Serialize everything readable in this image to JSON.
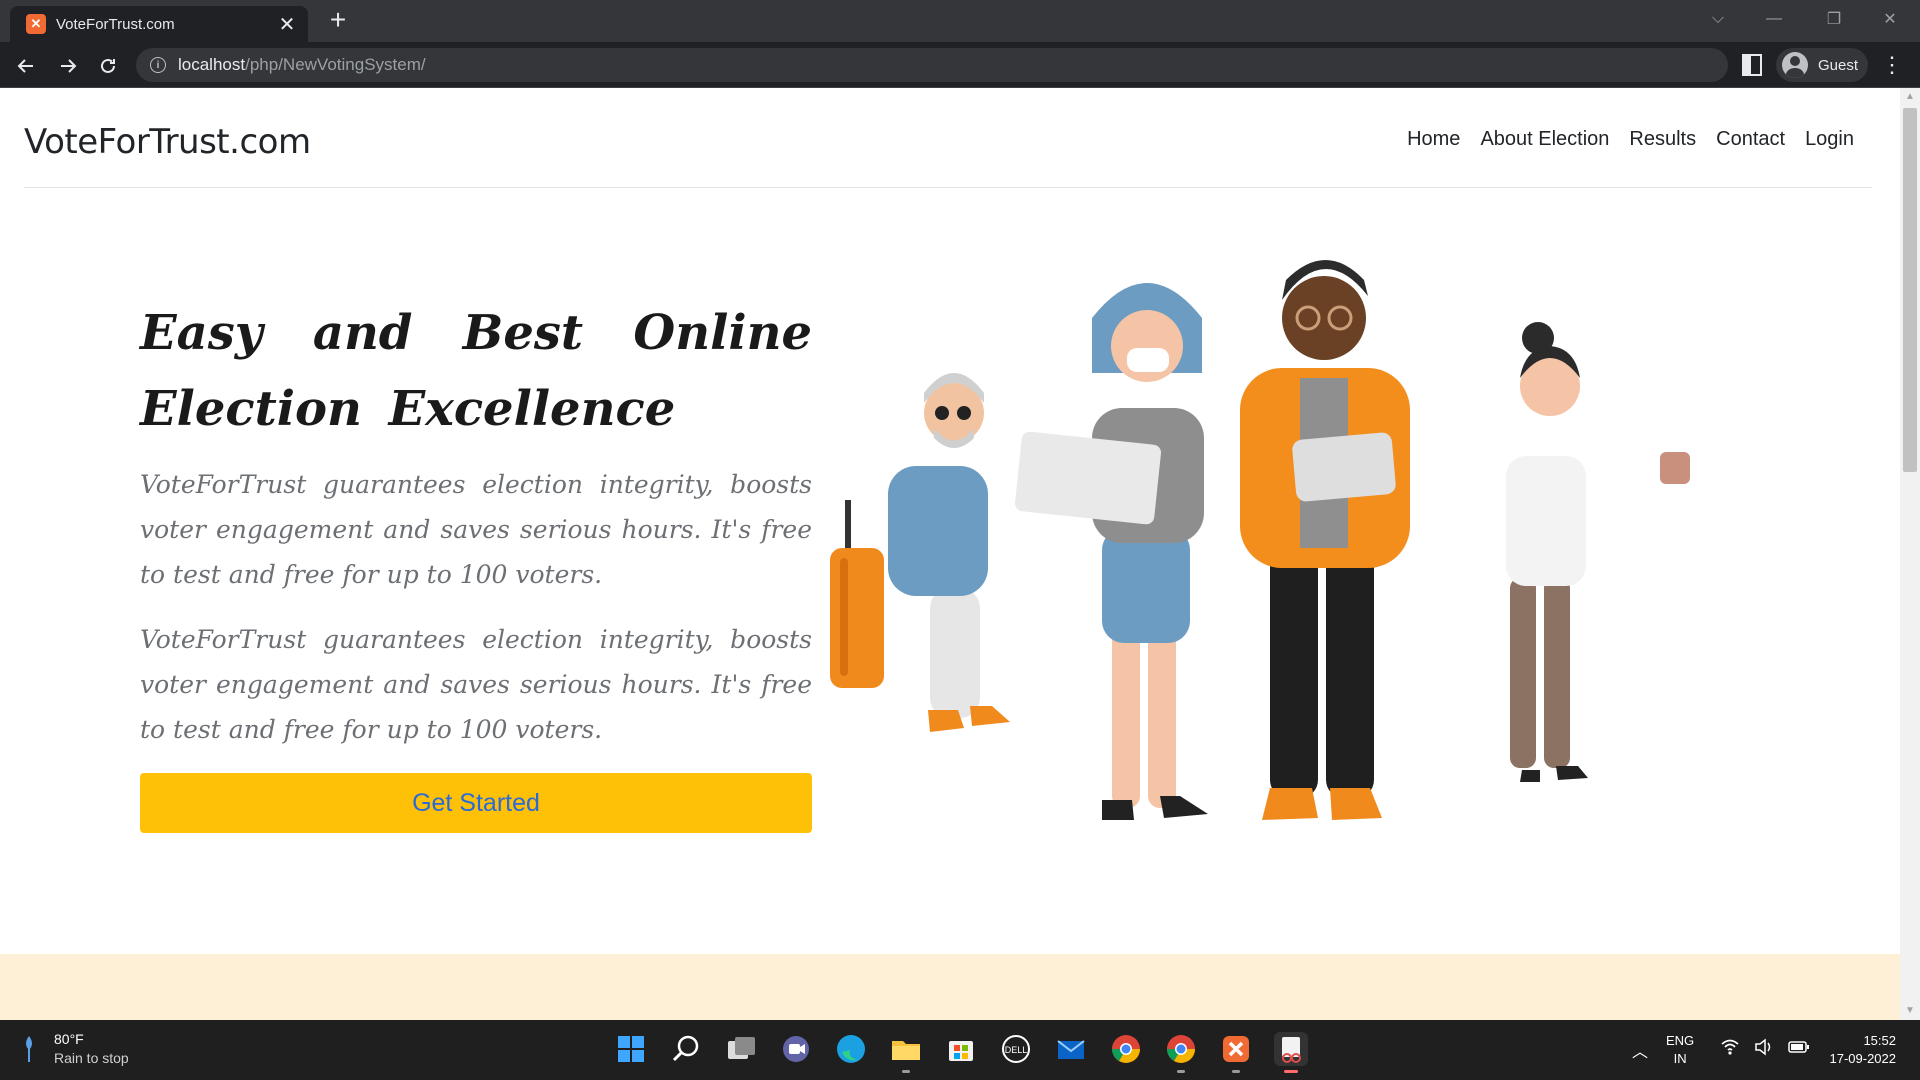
{
  "browser": {
    "tab_title": "VoteForTrust.com",
    "tab_close": "✕",
    "new_tab": "+",
    "url_host": "localhost",
    "url_path": "/php/NewVotingSystem/",
    "profile_label": "Guest",
    "controls": {
      "collapse": "⌵",
      "minimize": "—",
      "restore": "❐",
      "close": "✕"
    }
  },
  "site": {
    "brand": "VoteForTrust.com",
    "nav": [
      "Home",
      "About Election",
      "Results",
      "Contact",
      "Login"
    ]
  },
  "hero": {
    "title": "Easy and Best Online Election Excellence",
    "paragraphs": [
      "VoteForTrust guarantees election integrity, boosts voter engagement and saves serious hours. It's free to test and free for up to 100 voters.",
      "VoteForTrust guarantees election integrity, boosts voter engagement and saves serious hours. It's free to test and free for up to 100 voters."
    ],
    "cta_label": "Get Started"
  },
  "taskbar": {
    "weather_temp": "80°F",
    "weather_desc": "Rain to stop",
    "lang_line1": "ENG",
    "lang_line2": "IN",
    "time": "15:52",
    "date": "17-09-2022",
    "pinned_icons": [
      "start-icon",
      "search-icon",
      "task-view-icon",
      "teams-chat-icon",
      "edge-icon",
      "file-explorer-icon",
      "microsoft-store-icon",
      "dell-icon",
      "mail-icon",
      "chrome-icon",
      "chrome-profile-icon",
      "xampp-icon",
      "snipping-tool-icon"
    ]
  },
  "colors": {
    "accent_button": "#ffc107",
    "button_text": "#2a6bd7",
    "chrome_dark": "#202124",
    "taskbar": "#1f1f1f",
    "xampp_orange": "#f06a33"
  }
}
